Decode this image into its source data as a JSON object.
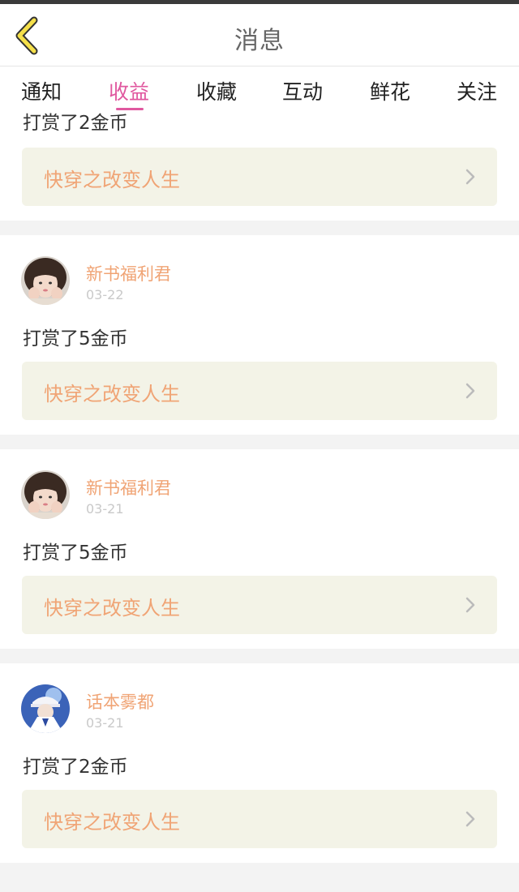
{
  "header": {
    "title": "消息"
  },
  "tabs": [
    {
      "label": "通知"
    },
    {
      "label": "收益"
    },
    {
      "label": "收藏"
    },
    {
      "label": "互动"
    },
    {
      "label": "鲜花"
    },
    {
      "label": "关注"
    }
  ],
  "active_tab": "收益",
  "colors": {
    "accent": "#e0589f",
    "username": "#f0a475",
    "book_box_bg": "#f3f3e7"
  },
  "partial_item": {
    "message": "打赏了2金币",
    "book": "快穿之改变人生"
  },
  "items": [
    {
      "user": "新书福利君",
      "date": "03-22",
      "message": "打赏了5金币",
      "book": "快穿之改变人生",
      "avatar": "girl-avatar"
    },
    {
      "user": "新书福利君",
      "date": "03-21",
      "message": "打赏了5金币",
      "book": "快穿之改变人生",
      "avatar": "girl-avatar"
    },
    {
      "user": "话本雾都",
      "date": "03-21",
      "message": "打赏了2金币",
      "book": "快穿之改变人生",
      "avatar": "anime-avatar"
    }
  ]
}
